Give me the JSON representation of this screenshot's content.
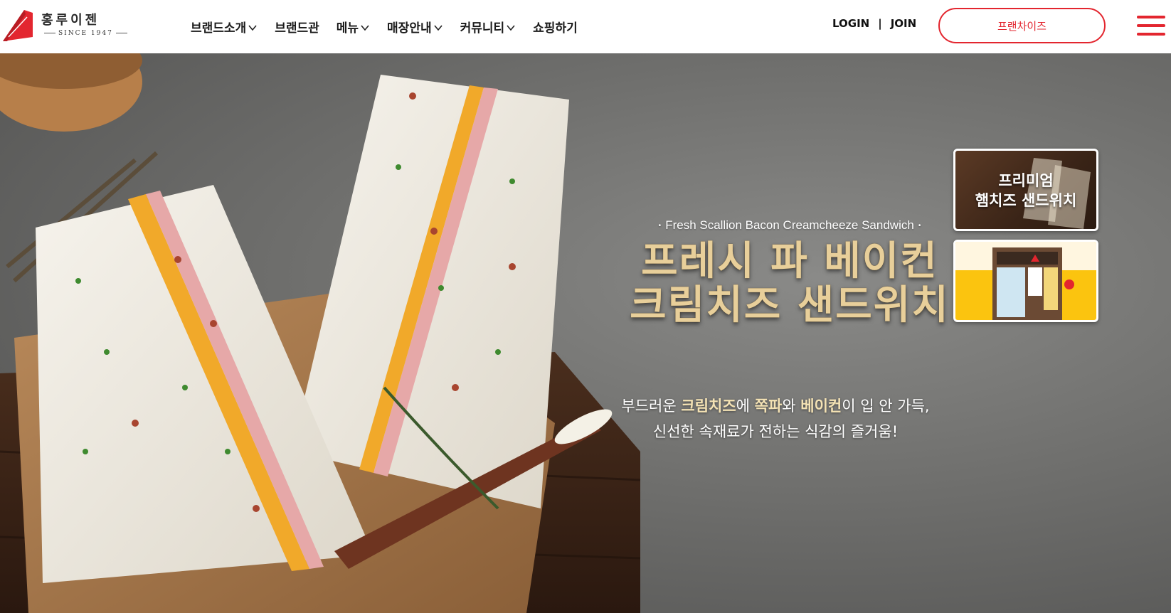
{
  "brand": {
    "name": "홍루이젠",
    "since": "SINCE 1947",
    "accent_color": "#e3262f"
  },
  "nav": {
    "items": [
      {
        "label": "브랜드소개",
        "has_dropdown": true
      },
      {
        "label": "브랜드관",
        "has_dropdown": false
      },
      {
        "label": "메뉴",
        "has_dropdown": true
      },
      {
        "label": "매장안내",
        "has_dropdown": true
      },
      {
        "label": "커뮤니티",
        "has_dropdown": true
      },
      {
        "label": "쇼핑하기",
        "has_dropdown": false
      }
    ]
  },
  "util": {
    "login": "LOGIN",
    "separator": "|",
    "join": "JOIN"
  },
  "franchise_button": "프랜차이즈",
  "menu_icon": "hamburger-icon",
  "hero": {
    "eyebrow": "Fresh Scallion Bacon Creamcheeze Sandwich",
    "title_line1": "프레시 파 베이컨",
    "title_line2": "크림치즈 샌드위치",
    "desc_line1": {
      "p1": "부드러운 ",
      "b1": "크림치즈",
      "p2": "에 ",
      "b2": "쪽파",
      "p3": "와 ",
      "b3": "베이컨",
      "p4": "이 입 안 가득,"
    },
    "desc_line2": "신선한 속재료가 전하는 식감의 즐거움!",
    "title_color": "#e8cf9a"
  },
  "side_cards": [
    {
      "label_line1": "프리미엄",
      "label_line2": "햄치즈 샌드위치"
    },
    {
      "label": ""
    }
  ]
}
